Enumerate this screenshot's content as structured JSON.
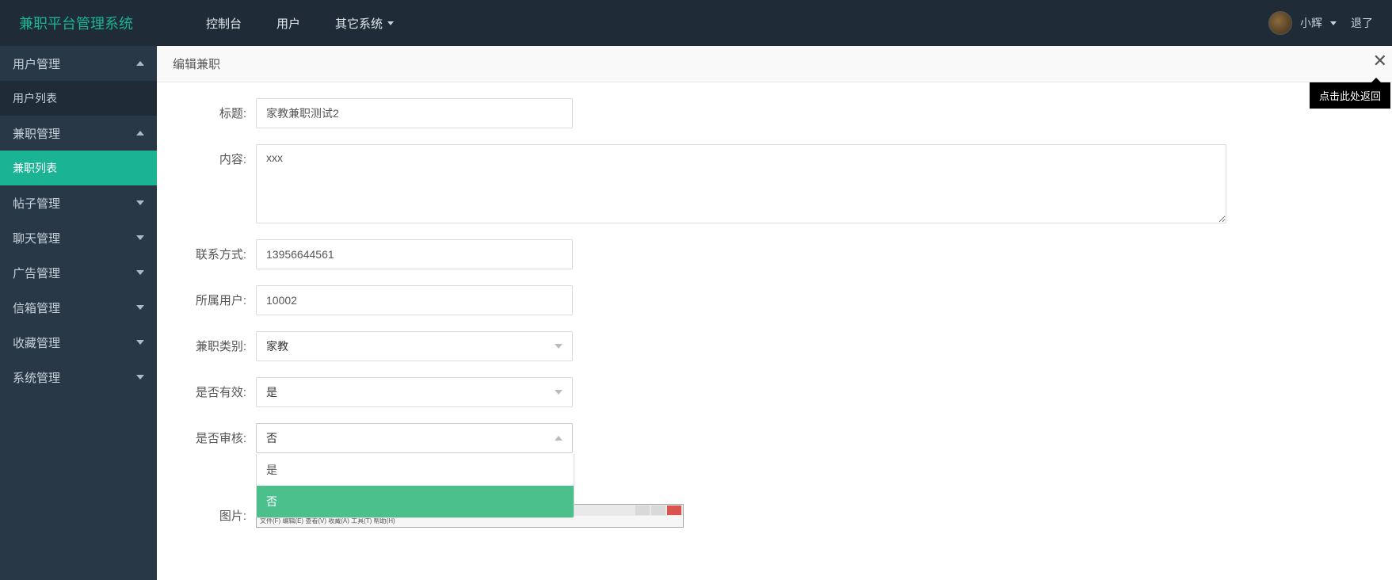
{
  "brand": "兼职平台管理系统",
  "nav": {
    "console": "控制台",
    "user": "用户",
    "other": "其它系统"
  },
  "user": {
    "name": "小辉"
  },
  "logout": "退了",
  "sidebar": {
    "groups": [
      {
        "label": "用户管理",
        "expanded": true,
        "sub": {
          "label": "用户列表",
          "active": false
        }
      },
      {
        "label": "兼职管理",
        "expanded": true,
        "sub": {
          "label": "兼职列表",
          "active": true
        }
      },
      {
        "label": "帖子管理",
        "expanded": false
      },
      {
        "label": "聊天管理",
        "expanded": false
      },
      {
        "label": "广告管理",
        "expanded": false
      },
      {
        "label": "信箱管理",
        "expanded": false
      },
      {
        "label": "收藏管理",
        "expanded": false
      },
      {
        "label": "系统管理",
        "expanded": false
      }
    ]
  },
  "page": {
    "title": "编辑兼职",
    "close_tooltip": "点击此处返回"
  },
  "form": {
    "title": {
      "label": "标题:",
      "value": "家教兼职测试2"
    },
    "content": {
      "label": "内容:",
      "value": "xxx"
    },
    "contact": {
      "label": "联系方式:",
      "value": "13956644561"
    },
    "owner": {
      "label": "所属用户:",
      "value": "10002"
    },
    "category": {
      "label": "兼职类别:",
      "value": "家教"
    },
    "valid": {
      "label": "是否有效:",
      "value": "是"
    },
    "audit": {
      "label": "是否审核:",
      "value": "否",
      "options": {
        "yes": "是",
        "no": "否"
      }
    },
    "picture": {
      "label": "图片:"
    }
  },
  "pic_window_menu": "文件(F)  编辑(E)  查看(V)  收藏(A)  工具(T)  帮助(H)"
}
